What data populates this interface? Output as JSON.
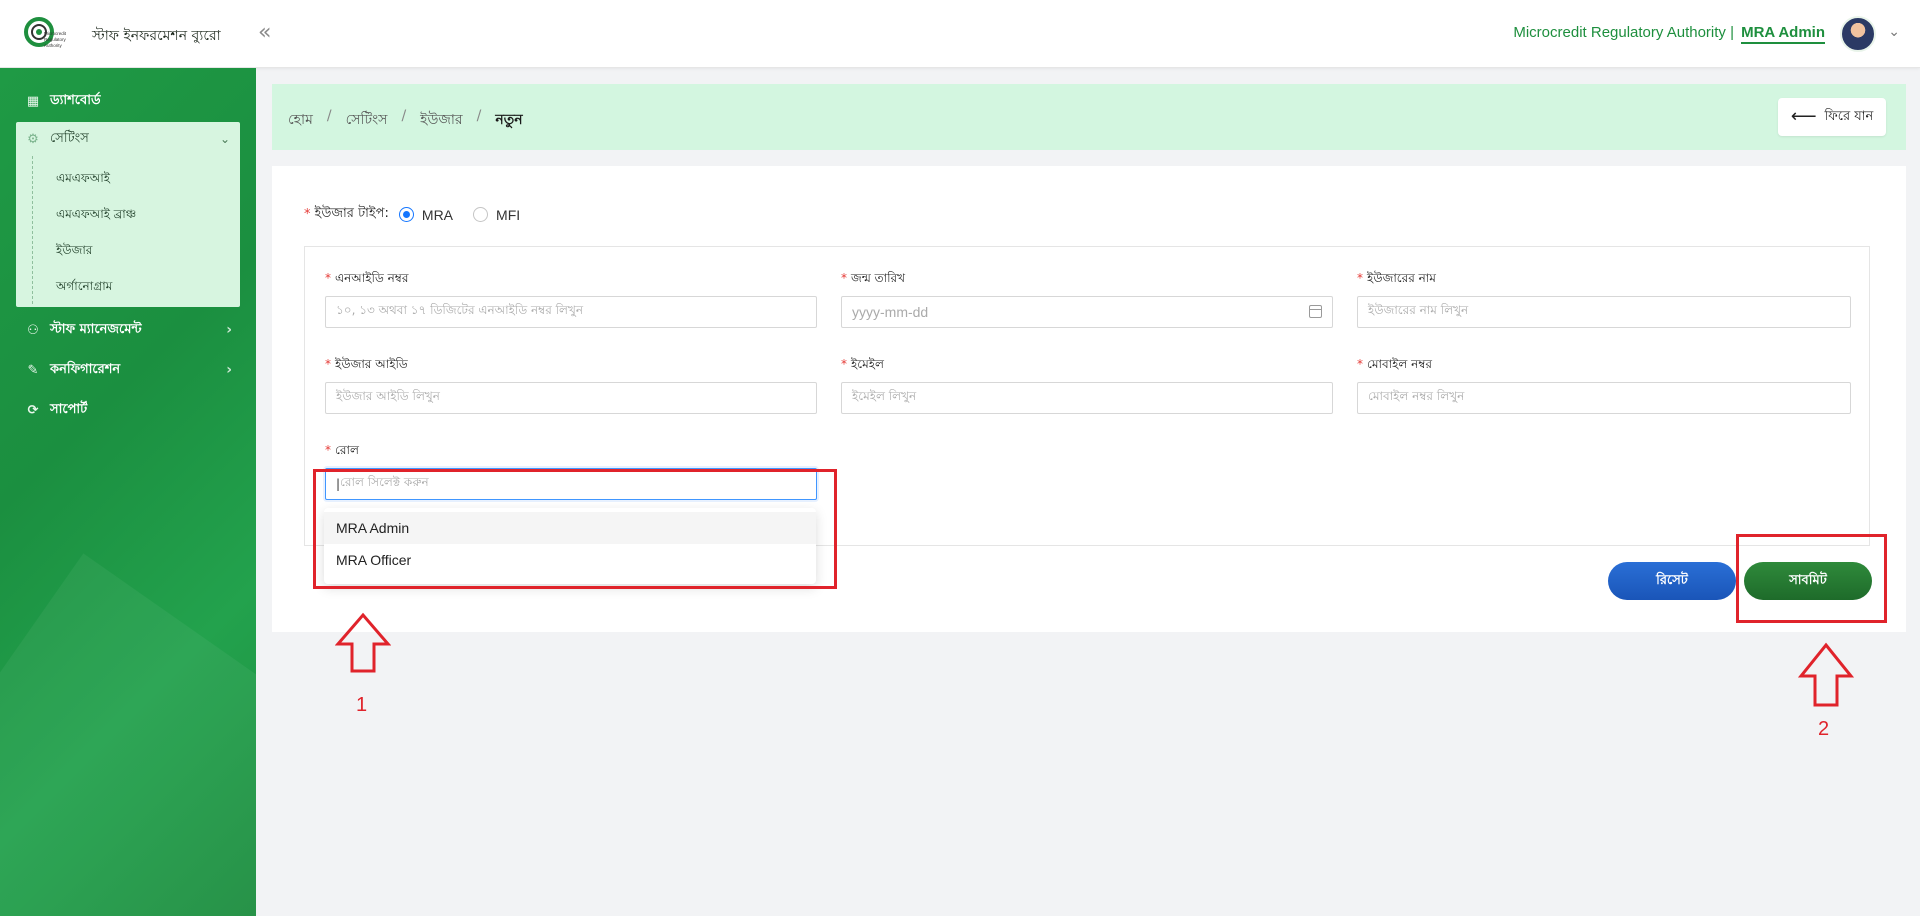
{
  "header": {
    "app_name": "স্টাফ ইনফরমেশন ব্যুরো",
    "logo_text": "Microcredit Regulatory Authority",
    "org_name": "Microcredit Regulatory Authority |",
    "user_name": "MRA Admin"
  },
  "sidebar": {
    "dashboard": "ড্যাশবোর্ড",
    "settings": "সেটিংস",
    "settings_items": [
      "এমএফআই",
      "এমএফআই ব্রাঞ্চ",
      "ইউজার",
      "অর্গানোগ্রাম"
    ],
    "staff_management": "স্টাফ ম্যানেজমেন্ট",
    "configuration": "কনফিগারেশন",
    "support": "সাপোর্ট"
  },
  "breadcrumb": {
    "items": [
      "হোম",
      "সেটিংস",
      "ইউজার"
    ],
    "current": "নতুন",
    "separator": "/",
    "back_label": "ফিরে যান"
  },
  "form": {
    "user_type_label": "ইউজার টাইপ:",
    "user_type_options": [
      "MRA",
      "MFI"
    ],
    "user_type_selected": "MRA",
    "fields": {
      "nid": {
        "label": "এনআইডি নম্বর",
        "placeholder": "১০, ১৩ অথবা ১৭ ডিজিটের এনআইডি নম্বর লিখুন"
      },
      "dob": {
        "label": "জন্ম তারিখ",
        "placeholder": "yyyy-mm-dd"
      },
      "username": {
        "label": "ইউজারের নাম",
        "placeholder": "ইউজারের নাম লিখুন"
      },
      "user_id": {
        "label": "ইউজার আইডি",
        "placeholder": "ইউজার আইডি লিখুন"
      },
      "email": {
        "label": "ইমেইল",
        "placeholder": "ইমেইল লিখুন"
      },
      "mobile": {
        "label": "মোবাইল নম্বর",
        "placeholder": "মোবাইল নম্বর লিখুন"
      },
      "role": {
        "label": "রোল",
        "placeholder": "রোল সিলেক্ট করুন"
      }
    },
    "role_options": [
      "MRA Admin",
      "MRA Officer"
    ],
    "reset_label": "রিসেট",
    "submit_label": "সাবমিট"
  },
  "annotations": {
    "label_1": "1",
    "label_2": "2",
    "color": "#e0232b"
  },
  "colors": {
    "brand_green": "#1e8f3e",
    "sidebar_green": "#1f9a45",
    "breadcrumb_bg": "#d3f6e0",
    "reset_blue": "#1a55b8",
    "submit_green": "#1e6b2a"
  }
}
